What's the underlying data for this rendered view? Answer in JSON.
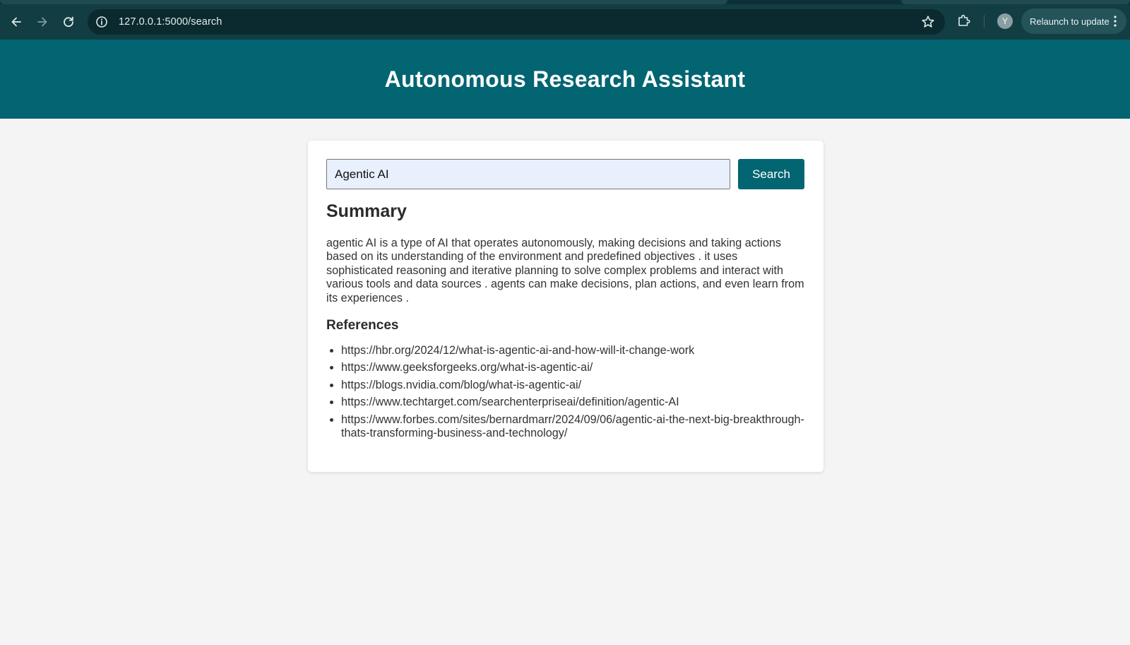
{
  "browser": {
    "url": "127.0.0.1:5000/search",
    "avatar_initial": "Y",
    "relaunch_label": "Relaunch to update"
  },
  "page": {
    "title": "Autonomous Research Assistant"
  },
  "search": {
    "value": "Agentic AI",
    "button_label": "Search"
  },
  "summary": {
    "heading": "Summary",
    "text": "agentic AI is a type of AI that operates autonomously, making decisions and taking actions based on its understanding of the environment and predefined objectives . it uses sophisticated reasoning and iterative planning to solve complex problems and interact with various tools and data sources . agents can make decisions, plan actions, and even learn from its experiences ."
  },
  "references": {
    "heading": "References",
    "items": [
      "https://hbr.org/2024/12/what-is-agentic-ai-and-how-will-it-change-work",
      "https://www.geeksforgeeks.org/what-is-agentic-ai/",
      "https://blogs.nvidia.com/blog/what-is-agentic-ai/",
      "https://www.techtarget.com/searchenterpriseai/definition/agentic-AI",
      "https://www.forbes.com/sites/bernardmarr/2024/09/06/agentic-ai-the-next-big-breakthrough-thats-transforming-business-and-technology/"
    ]
  },
  "colors": {
    "header_bg": "#036572",
    "button_bg": "#036572",
    "input_bg": "#e8f0fe",
    "page_bg": "#f4f4f4",
    "browser_toolbar": "#123d43"
  },
  "icons": {
    "back": "arrow-left-icon",
    "forward": "arrow-right-icon",
    "reload": "reload-icon",
    "site_info": "info-icon",
    "bookmark": "star-icon",
    "extensions": "puzzle-icon",
    "menu": "kebab-menu-icon"
  }
}
